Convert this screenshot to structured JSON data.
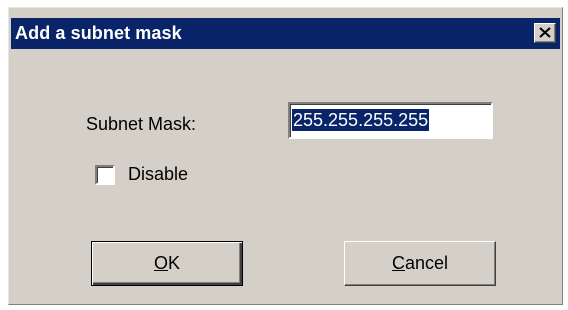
{
  "window": {
    "title": "Add a subnet mask",
    "close_icon": "close-x-icon"
  },
  "form": {
    "subnet_mask_label": "Subnet Mask:",
    "subnet_mask_value": "255.255.255.255",
    "disable_label": "Disable",
    "disable_checked": false
  },
  "buttons": {
    "ok_mnemonic": "O",
    "ok_rest": "K",
    "cancel_mnemonic": "C",
    "cancel_rest": "ancel"
  }
}
